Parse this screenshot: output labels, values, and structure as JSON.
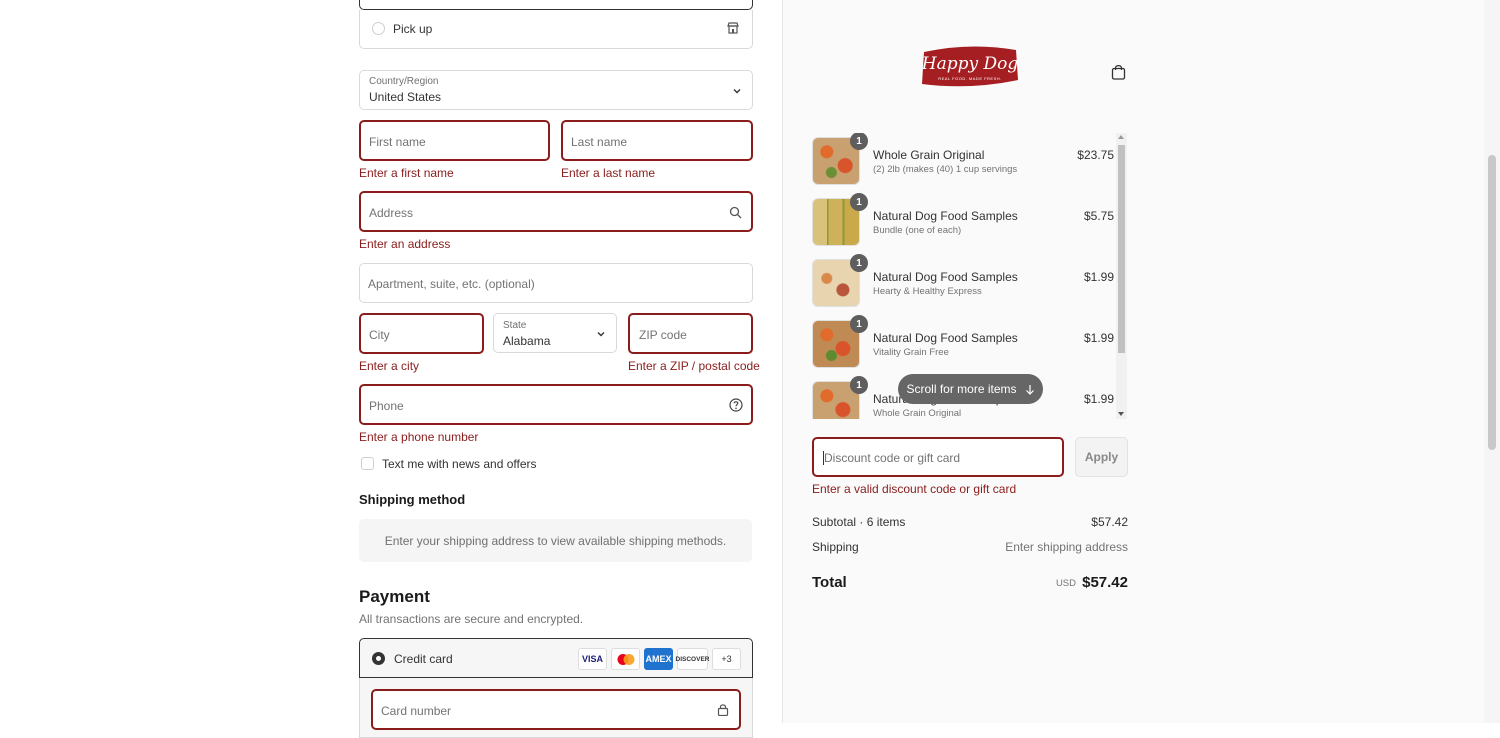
{
  "delivery": {
    "pickup_label": "Pick up"
  },
  "address": {
    "country_label": "Country/Region",
    "country_value": "United States",
    "first_name_placeholder": "First name",
    "first_name_error": "Enter a first name",
    "last_name_placeholder": "Last name",
    "last_name_error": "Enter a last name",
    "address_placeholder": "Address",
    "address_error": "Enter an address",
    "apartment_placeholder": "Apartment, suite, etc. (optional)",
    "city_placeholder": "City",
    "city_error": "Enter a city",
    "state_label": "State",
    "state_value": "Alabama",
    "zip_placeholder": "ZIP code",
    "zip_error": "Enter a ZIP / postal code",
    "phone_placeholder": "Phone",
    "phone_error": "Enter a phone number",
    "text_me_label": "Text me with news and offers"
  },
  "shipping": {
    "heading": "Shipping method",
    "notice": "Enter your shipping address to view available shipping methods."
  },
  "payment": {
    "heading": "Payment",
    "subtitle": "All transactions are secure and encrypted.",
    "method_label": "Credit card",
    "cards": [
      "VISA",
      "MC",
      "AMEX",
      "DISCOVER",
      "+3"
    ],
    "card_number_placeholder": "Card number"
  },
  "brand": {
    "logo_text": "Happy Dog",
    "tagline": "REAL FOOD. MADE FRESH."
  },
  "cart": {
    "items": [
      {
        "qty": "1",
        "name": "Whole Grain Original",
        "variant": "(2) 2lb (makes (40) 1 cup servings",
        "price": "$23.75"
      },
      {
        "qty": "1",
        "name": "Natural Dog Food Samples",
        "variant": "Bundle (one of each)",
        "price": "$5.75"
      },
      {
        "qty": "1",
        "name": "Natural Dog Food Samples",
        "variant": "Hearty & Healthy Express",
        "price": "$1.99"
      },
      {
        "qty": "1",
        "name": "Natural Dog Food Samples",
        "variant": "Vitality Grain Free",
        "price": "$1.99"
      },
      {
        "qty": "1",
        "name": "Natural Dog Food Samples",
        "variant": "Whole Grain Original",
        "price": "$1.99"
      }
    ],
    "scroll_hint": "Scroll for more items"
  },
  "discount": {
    "placeholder": "Discount code or gift card",
    "apply_label": "Apply",
    "error": "Enter a valid discount code or gift card"
  },
  "summary": {
    "subtotal_label": "Subtotal · 6 items",
    "subtotal_value": "$57.42",
    "shipping_label": "Shipping",
    "shipping_value": "Enter shipping address",
    "total_label": "Total",
    "currency": "USD",
    "total_value": "$57.42"
  },
  "colors": {
    "error": "#8a1c1c",
    "brand_red": "#a51e22"
  }
}
